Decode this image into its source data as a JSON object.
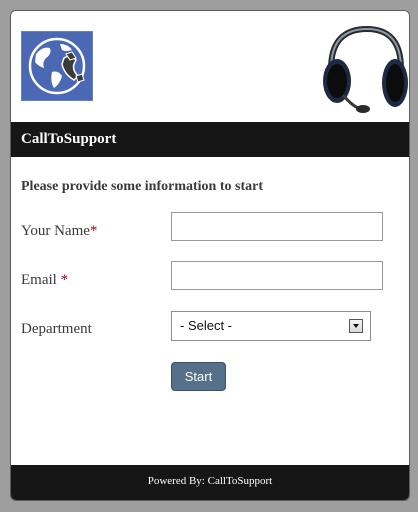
{
  "header": {
    "logo_icon": "globe-phone-icon",
    "headset_icon": "headset-icon"
  },
  "titlebar": {
    "title": "CallToSupport"
  },
  "form": {
    "intro": "Please provide some information to start",
    "name_label": "Your Name",
    "email_label": "Email ",
    "required_marker": "*",
    "name_value": "",
    "email_value": "",
    "department_label": "Department",
    "department_selected": "- Select -",
    "start_label": "Start"
  },
  "footer": {
    "text": "Powered By: CallToSupport"
  },
  "colors": {
    "background": "#9e9e9e",
    "bar": "#161616",
    "required": "#a0001c",
    "button": "#567089",
    "logo": "#4a68b4"
  }
}
